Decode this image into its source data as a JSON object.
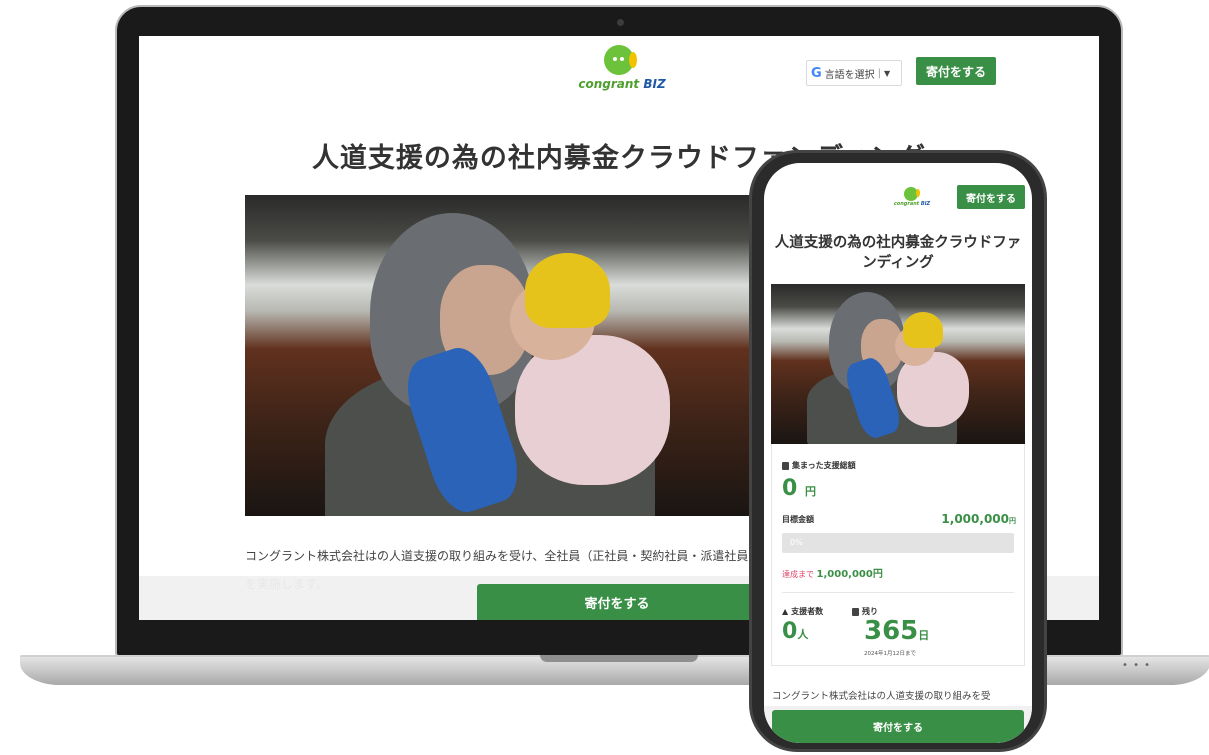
{
  "desktop": {
    "logo": {
      "name": "congrant",
      "suffix": "BIZ"
    },
    "language_selector": {
      "label": "言語を選択",
      "arrow": "▼"
    },
    "donate_top_label": "寄付をする",
    "title": "人道支援の為の社内募金クラウドファンディング",
    "body_line1": "コングラント株式会社はの人道支援の取り組みを受け、全社員（正社員・契約社員・派遣社員",
    "body_line2": "を実施します。",
    "donate_bottom_label": "寄付をする"
  },
  "phone": {
    "donate_top_label": "寄付をする",
    "title": "人道支援の為の社内募金クラウドファンディング",
    "raised": {
      "label": "集まった支援総額",
      "value": "0",
      "unit": "円"
    },
    "goal": {
      "label": "目標金額",
      "value": "1,000,000",
      "unit": "円"
    },
    "progress": {
      "percent": 0,
      "label": "0%"
    },
    "remaining": {
      "prefix": "達成まで",
      "value": "1,000,000円"
    },
    "supporters": {
      "label": "支援者数",
      "value": "0",
      "unit": "人"
    },
    "days_left": {
      "label": "残り",
      "value": "365",
      "unit": "日",
      "until": "2024年1月12日まで"
    },
    "body_text": "コングラント株式会社はの人道支援の取り組みを受",
    "donate_bottom_label": "寄付をする"
  },
  "colors": {
    "brand_green": "#3a8f46",
    "alert_pink": "#e2476a",
    "logo_green": "#6cc23a",
    "logo_blue": "#1f58a8"
  },
  "icons": [
    "google-icon",
    "wallet-icon",
    "user-icon",
    "calendar-icon",
    "congrant-logo"
  ]
}
